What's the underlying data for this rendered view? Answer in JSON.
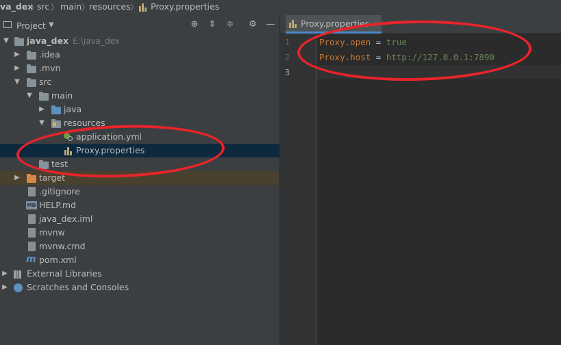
{
  "breadcrumb": {
    "items": [
      "va_dex",
      "src",
      "main",
      "resources",
      "Proxy.properties"
    ]
  },
  "project_panel": {
    "title": "Project",
    "header_icons": [
      "crosshair-icon",
      "expand-all-icon",
      "collapse-all-icon",
      "gear-icon",
      "minimize-icon"
    ],
    "tree": [
      {
        "label": "java_dex",
        "path": "E:\\java_dex",
        "icon": "module-folder-icon",
        "expanded": true
      },
      {
        "label": ".idea",
        "icon": "folder-icon",
        "expanded": false
      },
      {
        "label": ".mvn",
        "icon": "folder-icon",
        "expanded": false
      },
      {
        "label": "src",
        "icon": "folder-icon",
        "expanded": true
      },
      {
        "label": "main",
        "icon": "folder-icon",
        "expanded": true
      },
      {
        "label": "java",
        "icon": "source-folder-icon",
        "expanded": false
      },
      {
        "label": "resources",
        "icon": "resources-folder-icon",
        "expanded": true
      },
      {
        "label": "application.yml",
        "icon": "spring-yml-icon"
      },
      {
        "label": "Proxy.properties",
        "icon": "properties-file-icon",
        "selected": true
      },
      {
        "label": "test",
        "icon": "folder-icon",
        "expanded": false
      },
      {
        "label": "target",
        "icon": "excluded-folder-icon",
        "expanded": false
      },
      {
        "label": ".gitignore",
        "icon": "gitignore-file-icon"
      },
      {
        "label": "HELP.md",
        "icon": "markdown-file-icon"
      },
      {
        "label": "java_dex.iml",
        "icon": "iml-file-icon"
      },
      {
        "label": "mvnw",
        "icon": "script-file-icon"
      },
      {
        "label": "mvnw.cmd",
        "icon": "script-file-icon"
      },
      {
        "label": "pom.xml",
        "icon": "maven-icon"
      },
      {
        "label": "External Libraries",
        "icon": "libraries-icon",
        "expanded": false
      },
      {
        "label": "Scratches and Consoles",
        "icon": "scratches-icon",
        "expanded": false
      }
    ]
  },
  "editor": {
    "tab_label": "Proxy.properties",
    "line_numbers": [
      "1",
      "2",
      "3"
    ],
    "lines": [
      {
        "key": "Proxy.open",
        "eq": " = ",
        "value": "true"
      },
      {
        "key": "Proxy.host",
        "eq": " = ",
        "value": "http://127.0.0.1:7890"
      }
    ]
  },
  "colors": {
    "annotation": "#e8242b",
    "selection": "#0d293e",
    "excluded_row": "#49412e",
    "property_key": "#cc7832",
    "property_value": "#6a8759"
  }
}
